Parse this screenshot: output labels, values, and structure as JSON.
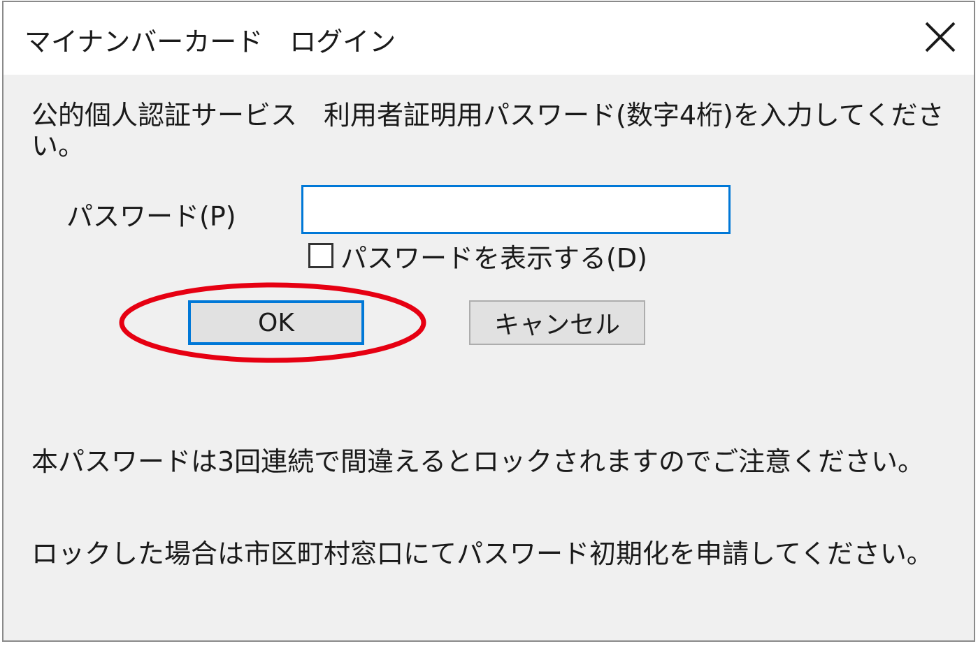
{
  "window": {
    "title": "マイナンバーカード　ログイン"
  },
  "dialog": {
    "message": "公的個人認証サービス　利用者証明用パスワード(数字4桁)を入力してください。",
    "password_label": "パスワード(P)",
    "password_value": "",
    "show_password_label": "パスワードを表示する(D)",
    "show_password_checked": false,
    "ok_label": "OK",
    "cancel_label": "キャンセル",
    "notice_lines": [
      "本パスワードは3回連続で間違えるとロックされますのでご注意ください。",
      "ロックした場合は市区町村窓口にてパスワード初期化を申請してください。"
    ]
  },
  "colors": {
    "focus": "#0078d7",
    "highlight": "#e60012",
    "dialog_bg": "#f0f0f0"
  },
  "icons": {
    "close": "close-icon"
  }
}
